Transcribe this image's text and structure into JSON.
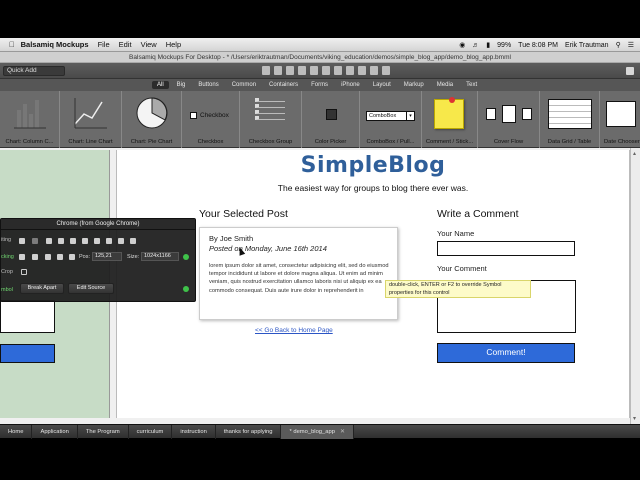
{
  "menubar": {
    "app_name": "Balsamiq Mockups",
    "menus": [
      "File",
      "Edit",
      "View",
      "Help"
    ],
    "battery": "99%",
    "clock": "Tue 8:08 PM",
    "user": "Erik Trautman"
  },
  "window": {
    "title": "Balsamiq Mockups For Desktop - * /Users/eriktrautman/Documents/viking_education/demos/simple_blog_app/demo_blog_app.bmml"
  },
  "toolbar": {
    "quick_add_placeholder": "Quick Add"
  },
  "categories": {
    "tabs": [
      "All",
      "Big",
      "Buttons",
      "Common",
      "Containers",
      "Forms",
      "iPhone",
      "Layout",
      "Markup",
      "Media",
      "Text"
    ],
    "active": "All"
  },
  "library": {
    "items": [
      {
        "label": "Chart: Column C..."
      },
      {
        "label": "Chart: Line Chart"
      },
      {
        "label": "Chart: Pie Chart"
      },
      {
        "label": "Checkbox"
      },
      {
        "label": "Checkbox Group"
      },
      {
        "label": "Color Picker"
      },
      {
        "label": "ComboBox / Pull..."
      },
      {
        "label": "Comment / Stick..."
      },
      {
        "label": "Cover Flow"
      },
      {
        "label": "Data Grid / Table"
      },
      {
        "label": "Date Chooser"
      }
    ],
    "checkbox_text": "Checkbox",
    "combobox_text": "ComboBox"
  },
  "mockup": {
    "blog_title": "SimpleBlog",
    "tagline": "The easiest way for groups to blog there ever was.",
    "selected_post_heading": "Your Selected Post",
    "author": "By Joe Smith",
    "posted_on": "Posted on Monday, June 16th 2014",
    "lorem": "lorem ipsum dolor sit amet, consectetur adipisicing elit, sed do eiusmod tempor incididunt ut labore et dolore magna aliqua. Ut enim ad minim veniam, quis nostrud exercitation ullamco laboris nisi ut aliquip ex ea commodo consequat. Duis aute irure dolor in reprehenderit in",
    "back_link": "<< Go Back to Home Page",
    "comment_heading": "Write a Comment",
    "name_label": "Your Name",
    "comment_label": "Your Comment",
    "submit_label": "Comment!"
  },
  "tooltip": {
    "text": "double-click, ENTER or F2 to override Symbol properties for this control"
  },
  "chrome_panel": {
    "title": "Chrome (from Google Chrome)",
    "row_editing": "iting",
    "row_locking": "cking",
    "row_crop": "Crop",
    "row_symbol": "mbol",
    "pos_label": "Pos:",
    "pos_value": "125,21",
    "size_label": "Size:",
    "size_value": "1024x1166",
    "break_apart": "Break Apart",
    "edit_source": "Edit Source"
  },
  "taskbar": {
    "tabs": [
      "Home",
      "Application",
      "The Program",
      "curriculum",
      "instruction",
      "thanks for applying",
      "* demo_blog_app"
    ],
    "active_index": 6,
    "close_glyph": "✕"
  }
}
